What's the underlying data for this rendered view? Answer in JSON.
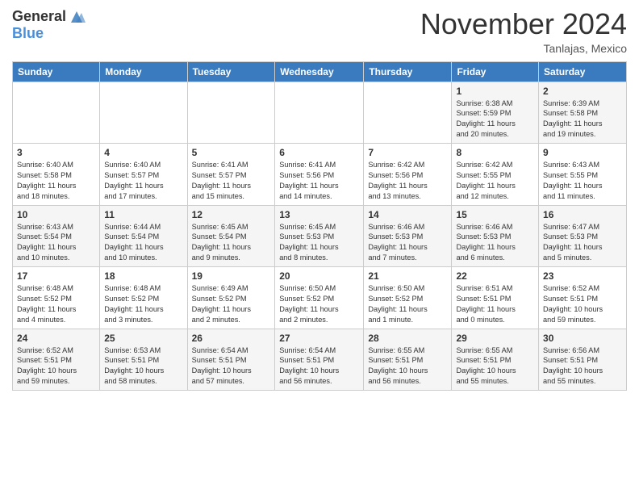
{
  "header": {
    "logo_general": "General",
    "logo_blue": "Blue",
    "month_title": "November 2024",
    "subtitle": "Tanlajas, Mexico"
  },
  "calendar": {
    "days_of_week": [
      "Sunday",
      "Monday",
      "Tuesday",
      "Wednesday",
      "Thursday",
      "Friday",
      "Saturday"
    ],
    "weeks": [
      [
        {
          "day": "",
          "info": ""
        },
        {
          "day": "",
          "info": ""
        },
        {
          "day": "",
          "info": ""
        },
        {
          "day": "",
          "info": ""
        },
        {
          "day": "",
          "info": ""
        },
        {
          "day": "1",
          "info": "Sunrise: 6:38 AM\nSunset: 5:59 PM\nDaylight: 11 hours\nand 20 minutes."
        },
        {
          "day": "2",
          "info": "Sunrise: 6:39 AM\nSunset: 5:58 PM\nDaylight: 11 hours\nand 19 minutes."
        }
      ],
      [
        {
          "day": "3",
          "info": "Sunrise: 6:40 AM\nSunset: 5:58 PM\nDaylight: 11 hours\nand 18 minutes."
        },
        {
          "day": "4",
          "info": "Sunrise: 6:40 AM\nSunset: 5:57 PM\nDaylight: 11 hours\nand 17 minutes."
        },
        {
          "day": "5",
          "info": "Sunrise: 6:41 AM\nSunset: 5:57 PM\nDaylight: 11 hours\nand 15 minutes."
        },
        {
          "day": "6",
          "info": "Sunrise: 6:41 AM\nSunset: 5:56 PM\nDaylight: 11 hours\nand 14 minutes."
        },
        {
          "day": "7",
          "info": "Sunrise: 6:42 AM\nSunset: 5:56 PM\nDaylight: 11 hours\nand 13 minutes."
        },
        {
          "day": "8",
          "info": "Sunrise: 6:42 AM\nSunset: 5:55 PM\nDaylight: 11 hours\nand 12 minutes."
        },
        {
          "day": "9",
          "info": "Sunrise: 6:43 AM\nSunset: 5:55 PM\nDaylight: 11 hours\nand 11 minutes."
        }
      ],
      [
        {
          "day": "10",
          "info": "Sunrise: 6:43 AM\nSunset: 5:54 PM\nDaylight: 11 hours\nand 10 minutes."
        },
        {
          "day": "11",
          "info": "Sunrise: 6:44 AM\nSunset: 5:54 PM\nDaylight: 11 hours\nand 10 minutes."
        },
        {
          "day": "12",
          "info": "Sunrise: 6:45 AM\nSunset: 5:54 PM\nDaylight: 11 hours\nand 9 minutes."
        },
        {
          "day": "13",
          "info": "Sunrise: 6:45 AM\nSunset: 5:53 PM\nDaylight: 11 hours\nand 8 minutes."
        },
        {
          "day": "14",
          "info": "Sunrise: 6:46 AM\nSunset: 5:53 PM\nDaylight: 11 hours\nand 7 minutes."
        },
        {
          "day": "15",
          "info": "Sunrise: 6:46 AM\nSunset: 5:53 PM\nDaylight: 11 hours\nand 6 minutes."
        },
        {
          "day": "16",
          "info": "Sunrise: 6:47 AM\nSunset: 5:53 PM\nDaylight: 11 hours\nand 5 minutes."
        }
      ],
      [
        {
          "day": "17",
          "info": "Sunrise: 6:48 AM\nSunset: 5:52 PM\nDaylight: 11 hours\nand 4 minutes."
        },
        {
          "day": "18",
          "info": "Sunrise: 6:48 AM\nSunset: 5:52 PM\nDaylight: 11 hours\nand 3 minutes."
        },
        {
          "day": "19",
          "info": "Sunrise: 6:49 AM\nSunset: 5:52 PM\nDaylight: 11 hours\nand 2 minutes."
        },
        {
          "day": "20",
          "info": "Sunrise: 6:50 AM\nSunset: 5:52 PM\nDaylight: 11 hours\nand 2 minutes."
        },
        {
          "day": "21",
          "info": "Sunrise: 6:50 AM\nSunset: 5:52 PM\nDaylight: 11 hours\nand 1 minute."
        },
        {
          "day": "22",
          "info": "Sunrise: 6:51 AM\nSunset: 5:51 PM\nDaylight: 11 hours\nand 0 minutes."
        },
        {
          "day": "23",
          "info": "Sunrise: 6:52 AM\nSunset: 5:51 PM\nDaylight: 10 hours\nand 59 minutes."
        }
      ],
      [
        {
          "day": "24",
          "info": "Sunrise: 6:52 AM\nSunset: 5:51 PM\nDaylight: 10 hours\nand 59 minutes."
        },
        {
          "day": "25",
          "info": "Sunrise: 6:53 AM\nSunset: 5:51 PM\nDaylight: 10 hours\nand 58 minutes."
        },
        {
          "day": "26",
          "info": "Sunrise: 6:54 AM\nSunset: 5:51 PM\nDaylight: 10 hours\nand 57 minutes."
        },
        {
          "day": "27",
          "info": "Sunrise: 6:54 AM\nSunset: 5:51 PM\nDaylight: 10 hours\nand 56 minutes."
        },
        {
          "day": "28",
          "info": "Sunrise: 6:55 AM\nSunset: 5:51 PM\nDaylight: 10 hours\nand 56 minutes."
        },
        {
          "day": "29",
          "info": "Sunrise: 6:55 AM\nSunset: 5:51 PM\nDaylight: 10 hours\nand 55 minutes."
        },
        {
          "day": "30",
          "info": "Sunrise: 6:56 AM\nSunset: 5:51 PM\nDaylight: 10 hours\nand 55 minutes."
        }
      ]
    ]
  }
}
